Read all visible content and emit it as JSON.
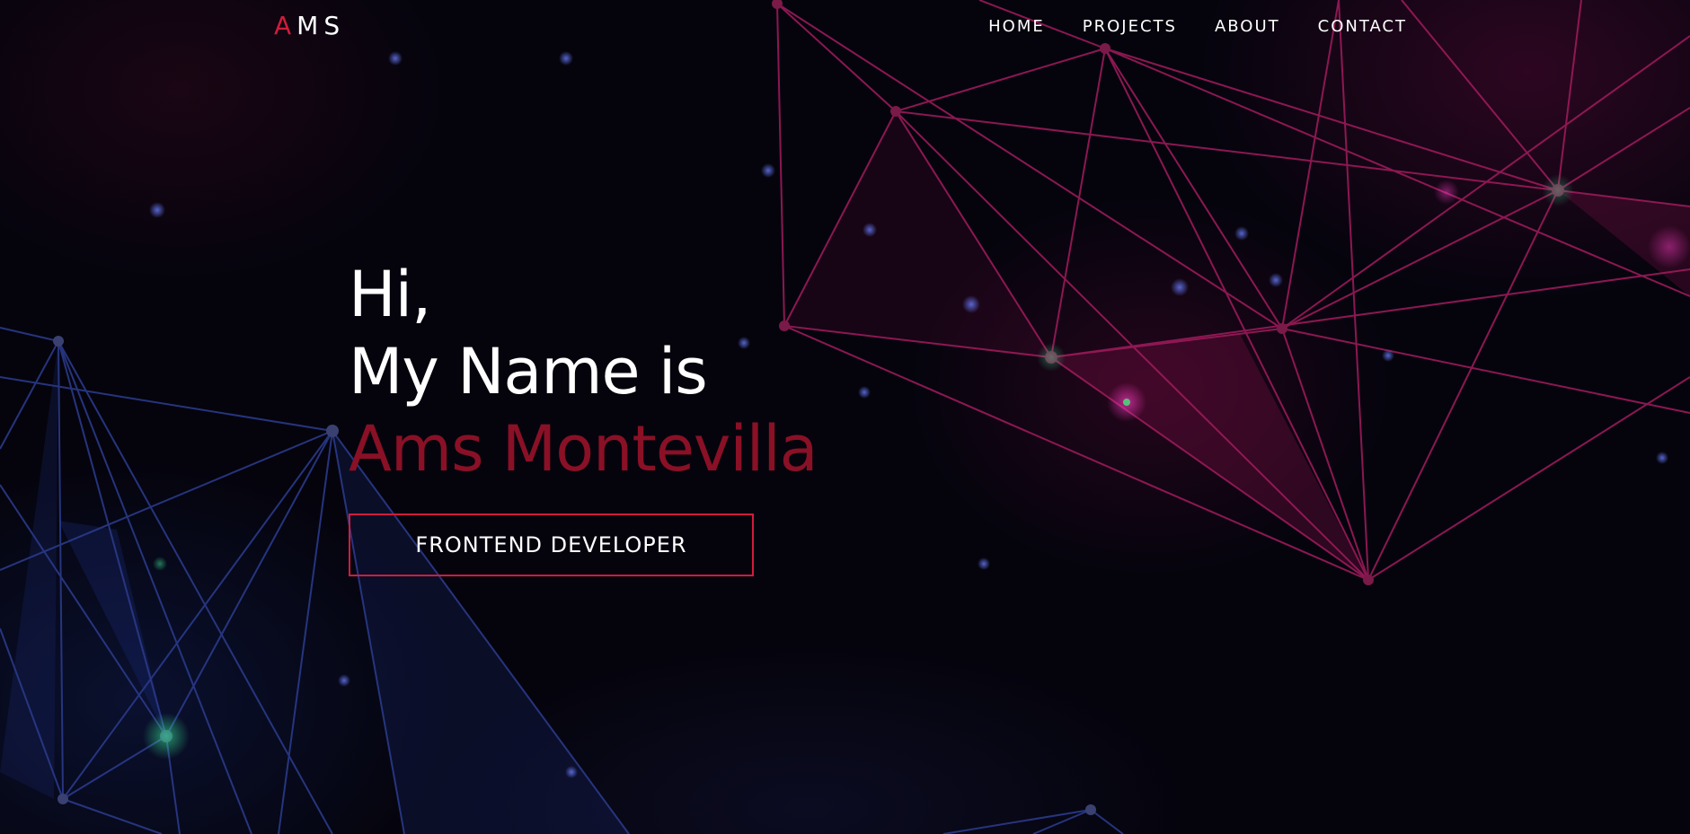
{
  "logo": {
    "first_letter": "A",
    "rest": "MS"
  },
  "nav": {
    "items": [
      {
        "label": "HOME"
      },
      {
        "label": "PROJECTS"
      },
      {
        "label": "ABOUT"
      },
      {
        "label": "CONTACT"
      }
    ]
  },
  "hero": {
    "greeting": "Hi,",
    "intro": "My Name is",
    "name": "Ams Montevilla",
    "role_button": "FRONTEND DEVELOPER"
  },
  "colors": {
    "accent": "#d01c3c",
    "name_color": "#8a1026",
    "background": "#05040d",
    "network_magenta": "#9b1a5a",
    "network_blue": "#2a3a8a"
  },
  "icons": {
    "background": "polygon-network-graphic"
  }
}
